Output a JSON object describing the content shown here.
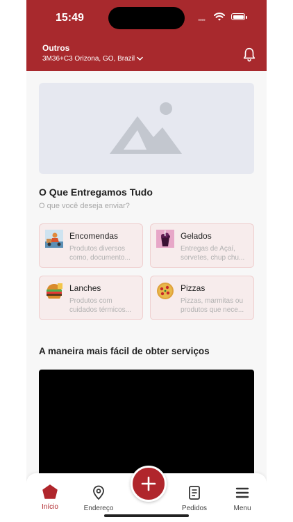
{
  "status_bar": {
    "time": "15:49",
    "signal": "••••"
  },
  "header": {
    "location_title": "Outros",
    "address": "3M36+C3 Orizona, GO, Brazil"
  },
  "section1": {
    "title": "O Que Entregamos Tudo",
    "subtitle": "O que você deseja enviar?"
  },
  "services": [
    {
      "name": "Encomendas",
      "desc1": "Produtos diversos",
      "desc2": "como, documento..."
    },
    {
      "name": "Gelados",
      "desc1": "Entregas de Açaí,",
      "desc2": "sorvetes, chup chu..."
    },
    {
      "name": "Lanches",
      "desc1": "Produtos com",
      "desc2": "cuidados térmicos..."
    },
    {
      "name": "Pizzas",
      "desc1": "Pizzas, marmitas ou",
      "desc2": "produtos que nece..."
    }
  ],
  "section2": {
    "title": "A maneira mais fácil de obter serviços"
  },
  "tabbar": {
    "home": "Início",
    "address": "Endereço",
    "orders": "Pedidos",
    "menu": "Menu"
  },
  "colors": {
    "brand": "#a8292d",
    "active_tab": "#b0262c"
  }
}
